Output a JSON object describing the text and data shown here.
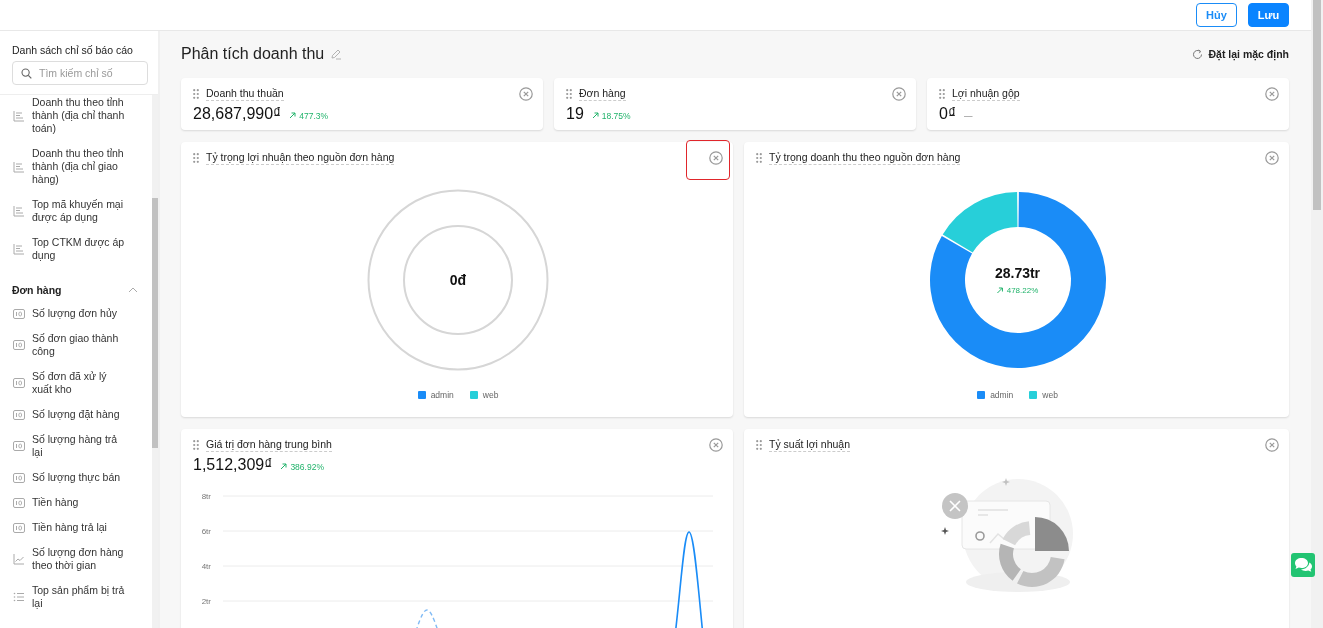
{
  "top_bar": {
    "buttons": [
      {
        "label": "Hủy",
        "kind": "secondary"
      },
      {
        "label": "Lưu",
        "kind": "primary"
      }
    ]
  },
  "sidebar": {
    "title": "Danh sách chỉ số báo cáo",
    "search": {
      "placeholder": "Tìm kiếm chỉ số"
    },
    "groups": [
      {
        "items": [
          {
            "label": "Doanh thu theo tỉnh thành (địa chỉ thanh toán)",
            "kind": "bar"
          },
          {
            "label": "Doanh thu theo tỉnh thành (địa chỉ giao hàng)",
            "kind": "bar"
          },
          {
            "label": "Top mã khuyến mại được áp dụng",
            "kind": "bar"
          },
          {
            "label": "Top CTKM được áp dụng",
            "kind": "bar"
          }
        ]
      },
      {
        "title": "Đơn hàng",
        "expanded": true,
        "items": [
          {
            "label": "Số lượng đơn hủy",
            "kind": "number"
          },
          {
            "label": "Số đơn giao thành công",
            "kind": "number"
          },
          {
            "label": "Số đơn đã xử lý xuất kho",
            "kind": "number"
          },
          {
            "label": "Số lượng đặt hàng",
            "kind": "number"
          },
          {
            "label": "Số lượng hàng trả lại",
            "kind": "number"
          },
          {
            "label": "Số lượng thực bán",
            "kind": "number"
          },
          {
            "label": "Tiền hàng",
            "kind": "number"
          },
          {
            "label": "Tiền hàng trả lại",
            "kind": "number"
          },
          {
            "label": "Số lượng đơn hàng theo thời gian",
            "kind": "line"
          },
          {
            "label": "Top sản phẩm bị trả lại",
            "kind": "list"
          }
        ]
      }
    ]
  },
  "main": {
    "title": "Phân tích doanh thu",
    "reset": "Đặt lại mặc định",
    "kpis": [
      {
        "label": "Doanh thu thuần",
        "value": "28,687,990₫",
        "change": "477.3%",
        "trending_up": true
      },
      {
        "label": "Đơn hàng",
        "value": "19",
        "change": "18.75%",
        "trending_up": true
      },
      {
        "label": "Lợi nhuận gộp",
        "value": "0₫",
        "change": "—",
        "trending_up": false
      }
    ],
    "widgets": [
      {
        "kind": "donut",
        "title": "Tỷ trọng lợi nhuận theo nguồn đơn hàng",
        "has_data": false,
        "center_value": "0đ",
        "close_highlighted": true,
        "legend": [
          {
            "label": "admin",
            "color": "#1a8cf7"
          },
          {
            "label": "web",
            "color": "#27cfd9"
          }
        ]
      },
      {
        "kind": "donut",
        "title": "Tỷ trọng doanh thu theo nguồn đơn hàng",
        "has_data": true,
        "center_value": "28.73tr",
        "change": "478.22%",
        "trending_up": true,
        "legend": [
          {
            "label": "admin",
            "color": "#1a8cf7"
          },
          {
            "label": "web",
            "color": "#27cfd9"
          }
        ]
      },
      {
        "kind": "line",
        "title": "Giá trị đơn hàng trung bình",
        "value": "1,512,309₫",
        "change": "386.92%",
        "trending_up": true,
        "y_ticks": [
          "8tr",
          "6tr",
          "4tr",
          "2tr"
        ]
      },
      {
        "kind": "empty",
        "title": "Tỷ suất lợi nhuận"
      }
    ]
  }
}
